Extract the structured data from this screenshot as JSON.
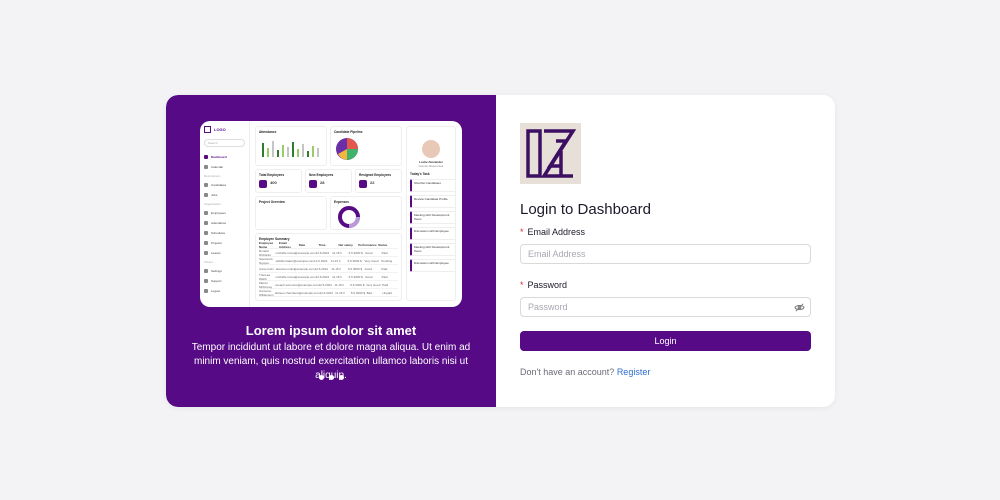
{
  "colors": {
    "brand": "#560a86",
    "background": "#f3f3f5",
    "link": "#2f6fd1",
    "required": "#e0243b"
  },
  "preview": {
    "logo_text": "LOGO",
    "search_placeholder": "Search",
    "nav": [
      {
        "label": "Dashboard",
        "active": true
      },
      {
        "label": "Calendar",
        "active": false
      },
      {
        "label": "Recruitment",
        "section": true
      },
      {
        "label": "Candidates",
        "active": false
      },
      {
        "label": "Jobs",
        "active": false
      },
      {
        "label": "Organization",
        "section": true
      },
      {
        "label": "Employees",
        "active": false
      },
      {
        "label": "Attendance",
        "active": false
      },
      {
        "label": "Schedules",
        "active": false
      },
      {
        "label": "Projects",
        "active": false
      },
      {
        "label": "Leaves",
        "active": false
      },
      {
        "label": "Others",
        "section": true
      },
      {
        "label": "Settings",
        "active": false
      },
      {
        "label": "Support",
        "active": false
      },
      {
        "label": "Logout",
        "active": false
      }
    ],
    "attendance_title": "Attendance",
    "attendance_filter": "Weekly",
    "pipeline_title": "Candidate Pipeline",
    "pipeline_filter": "Recent Month",
    "kpis": [
      {
        "label": "Total Employees",
        "value": "400"
      },
      {
        "label": "New Employees",
        "value": "28"
      },
      {
        "label": "Resigned Employees",
        "value": "22"
      }
    ],
    "project_title": "Project Overview",
    "expenses_title": "Expenses",
    "summary_title": "Employee Summary",
    "summary_headers": [
      "Employee Name",
      "Email Address",
      "Date",
      "Time",
      "Net salary",
      "Performance",
      "Status"
    ],
    "summary_rows": [
      [
        "Ronald Richards",
        "michelle.rivera@example.com",
        "12.6.2024",
        "11.15 h",
        "5.6 9000 $",
        "Good",
        "Paid"
      ],
      [
        "Savannah Nguyen",
        "debbie.baker@example.com",
        "12.6.2024",
        "11.15 h",
        "5.6 9000 $",
        "Very Good",
        "Pending"
      ],
      [
        "Annie Irwin",
        "deanna.curtis@example.com",
        "12.6.2024",
        "11.15 h",
        "5.6 9000 $",
        "Good",
        "Paid"
      ],
      [
        "Theresa Webb",
        "michelle.rivera@example.com",
        "12.6.2024",
        "11.15 h",
        "5.6 9000 $",
        "Good",
        "Paid"
      ],
      [
        "Marvin McKinney",
        "nevaeh.simmons@example.com",
        "12.6.2024",
        "11.15 h",
        "5.6 9000 $",
        "Very Good",
        "Paid"
      ],
      [
        "Cameron Williamson",
        "dolores.chambers@example.com",
        "12.6.2024",
        "11.15 h",
        "5.6 9000 $",
        "Bad",
        "Unpaid"
      ]
    ],
    "profile_name": "Leslie Alexander",
    "profile_role": "Human Resources",
    "todays_task": "Today's Task",
    "events": [
      "Shortlist Candidates",
      "Review Candidate Profile",
      "Meeting with Development Team",
      "Discussion with Employee",
      "Meeting with Development Team",
      "Discussion with Employee"
    ]
  },
  "slide": {
    "title": "Lorem ipsum dolor sit amet",
    "text": "Tempor incididunt ut labore et dolore magna aliqua. Ut enim ad minim veniam, quis nostrud exercitation ullamco laboris nisi ut aliquip.",
    "count": 3
  },
  "login": {
    "heading": "Login to Dashboard",
    "email_label": "Email Address",
    "email_placeholder": "Email Address",
    "password_label": "Password",
    "password_placeholder": "Password",
    "button_label": "Login",
    "register_prompt": "Don't have an account?",
    "register_link": "Register",
    "password_visibility_icon": "eye-off-icon"
  }
}
